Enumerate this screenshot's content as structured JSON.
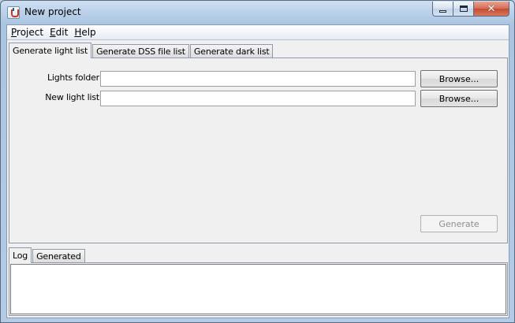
{
  "window": {
    "title": "New project",
    "close_glyph": "✕"
  },
  "menu": [
    {
      "mnemonic": "P",
      "rest": "roject"
    },
    {
      "mnemonic": "E",
      "rest": "dit"
    },
    {
      "mnemonic": "H",
      "rest": "elp"
    }
  ],
  "tabs": [
    {
      "label": "Generate light list",
      "active": true
    },
    {
      "label": "Generate DSS file list",
      "active": false
    },
    {
      "label": "Generate dark list",
      "active": false
    }
  ],
  "form": {
    "lights_folder_label": "Lights folder",
    "lights_folder_value": "",
    "new_light_list_label": "New light list",
    "new_light_list_value": "",
    "browse_label": "Browse...",
    "generate_label": "Generate"
  },
  "bottom_tabs": [
    {
      "label": "Log",
      "active": true
    },
    {
      "label": "Generated",
      "active": false
    }
  ],
  "log": {
    "content": ""
  },
  "icons": {
    "app": "java-cup-icon",
    "minimize": "minimize-icon",
    "maximize": "maximize-icon",
    "close": "close-icon"
  }
}
